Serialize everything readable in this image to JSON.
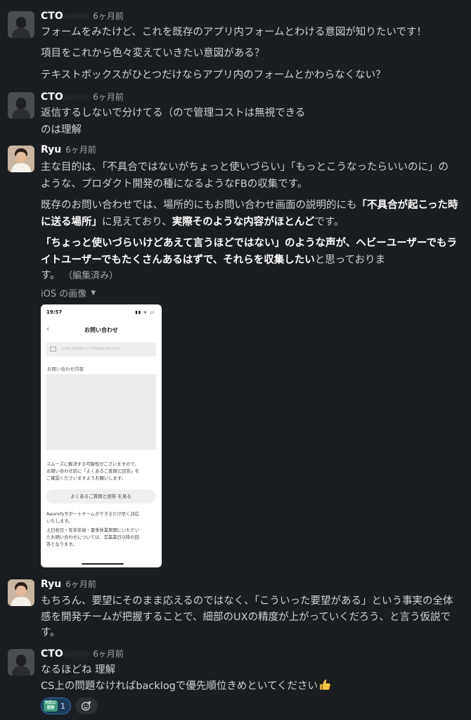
{
  "messages": [
    {
      "author": "CTO",
      "author_hidden": "sahiro",
      "time": "6ヶ月前",
      "lines": [
        "フォームをみたけど、これを既存のアプリ内フォームとわける意図が知りたいです！",
        "項目をこれから色々変えていきたい意図がある？",
        "テキストボックスがひとつだけならアプリ内のフォームとかわらなくない？"
      ]
    },
    {
      "author": "CTO",
      "author_hidden": "sahiro",
      "time": "6ヶ月前",
      "lines": [
        "返信するしないで分けてる（ので管理コストは無視できる",
        "のは理解"
      ]
    },
    {
      "author": "Ryu",
      "time": "6ヶ月前",
      "lines": [
        "主な目的は、「不具合ではないがちょっと使いづらい」「もっとこうなったらいいのに」の",
        "ような、プロダクト開発の種になるようなFBの収集です。"
      ],
      "para2": {
        "a": "既存のお問い合わせでは、場所的にもお問い合わせ画面の説明的にも",
        "b_bold": "「不具合が起こった時",
        "c_bold": "に送る場所」",
        "d": "に見えており、",
        "e_bold": "実際そのような内容がほとんど",
        "f": "です。"
      },
      "para3": {
        "a_bold": "「ちょっと使いづらいけどあえて言うほどではない」のような声が、ヘビーユーザーでもラ",
        "b_bold": "イトユーザーでもたくさんあるはずで、それらを収集したい",
        "c": "と思っておりま",
        "d": "す。",
        "edited": "（編集済み）"
      },
      "image_label": "iOS の画像",
      "phone": {
        "status_time": "19:57",
        "status_right": "▮▮ ᯤ ▭",
        "title": "お問い合わせ",
        "email_placeholder": "ryuki.hayato.1120@gmail.com",
        "content_label": "お問い合わせ内容",
        "note_lines": [
          "スムーズに解決する可能性がございますので、",
          "お問い合わせ前に「よくあるご質問と回答」を",
          "ご確認くださいますようお願いします。"
        ],
        "faq_button": "よくあるご質問と回答 を見る",
        "support_lines": [
          "Awarefyサポートチームができるだけ早く対応",
          "いたします。",
          "土日祝日・年末年始・夏季休業期間にいただい",
          "たお問い合わせについては、営業業日以降の回",
          "答となります。"
        ]
      }
    },
    {
      "author": "Ryu",
      "time": "6ヶ月前",
      "lines": [
        "もちろん、要望にそのまま応えるのではなく、「こういった要望がある」という事実の全体",
        "感を開発チームが把握することで、細部のUXの精度が上がっていくだろう、と言う仮説で",
        "す。"
      ]
    },
    {
      "author": "CTO",
      "author_hidden": "sahiro",
      "time": "6ヶ月前",
      "lines": [
        "なるほどね 理解",
        "CS上の問題なければbacklogで優先順位きめといてください"
      ],
      "reaction": {
        "emoji_text_1": "対応に",
        "emoji_text_2": "感謝",
        "count": "1"
      }
    }
  ],
  "icons": {
    "thumbs_up": "thumbs-up-icon",
    "add_reaction": "add-reaction-icon",
    "caret": "caret-down-icon"
  },
  "colors": {
    "background": "#1a1d21",
    "text": "#d1d2d3",
    "muted": "#a3a6aa",
    "reaction_border": "#2d6fb5"
  }
}
